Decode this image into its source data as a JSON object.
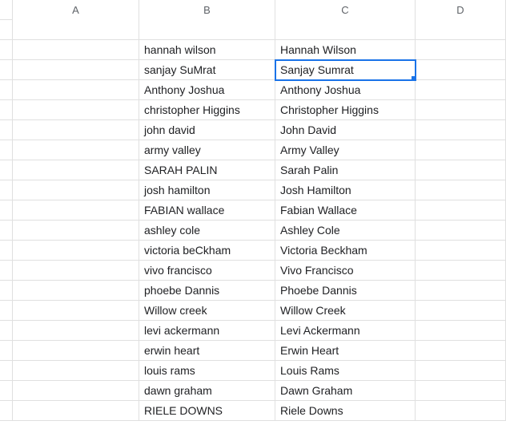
{
  "columns": [
    "A",
    "B",
    "C",
    "D"
  ],
  "selected": {
    "col": "C",
    "row": 2
  },
  "rows": [
    {
      "B": "",
      "C": ""
    },
    {
      "B": "hannah wilson",
      "C": "Hannah Wilson"
    },
    {
      "B": "sanjay SuMrat",
      "C": "Sanjay Sumrat"
    },
    {
      "B": "Anthony Joshua",
      "C": "Anthony Joshua"
    },
    {
      "B": "christopher Higgins",
      "C": "Christopher Higgins"
    },
    {
      "B": "john david",
      "C": "John David"
    },
    {
      "B": "army valley",
      "C": "Army Valley"
    },
    {
      "B": "SARAH PALIN",
      "C": "Sarah Palin"
    },
    {
      "B": "josh hamilton",
      "C": "Josh Hamilton"
    },
    {
      "B": "FABIAN wallace",
      "C": "Fabian Wallace"
    },
    {
      "B": "ashley cole",
      "C": "Ashley Cole"
    },
    {
      "B": "victoria beCkham",
      "C": "Victoria Beckham"
    },
    {
      "B": "vivo francisco",
      "C": "Vivo Francisco"
    },
    {
      "B": "phoebe Dannis",
      "C": "Phoebe Dannis"
    },
    {
      "B": "Willow creek",
      "C": "Willow Creek"
    },
    {
      "B": "levi ackermann",
      "C": "Levi Ackermann"
    },
    {
      "B": "erwin heart",
      "C": "Erwin Heart"
    },
    {
      "B": "louis rams",
      "C": "Louis Rams"
    },
    {
      "B": "dawn graham",
      "C": "Dawn Graham"
    },
    {
      "B": "RIELE DOWNS",
      "C": "Riele Downs"
    }
  ]
}
